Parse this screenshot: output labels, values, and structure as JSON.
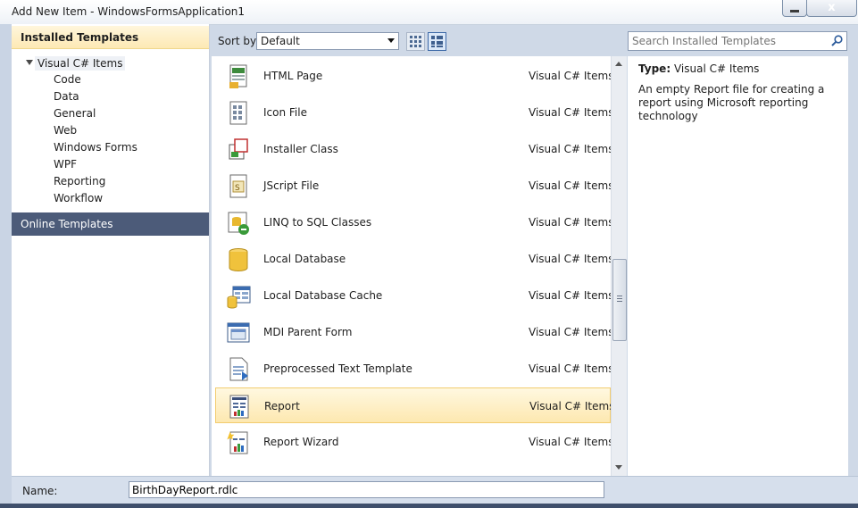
{
  "window": {
    "title": "Add New Item - WindowsFormsApplication1",
    "close_label": "x"
  },
  "left_panel": {
    "installed_header": "Installed Templates",
    "root_label": "Visual C# Items",
    "children": [
      "Code",
      "Data",
      "General",
      "Web",
      "Windows Forms",
      "WPF",
      "Reporting",
      "Workflow"
    ],
    "online_header": "Online Templates"
  },
  "toolbar": {
    "sort_label": "Sort by:",
    "sort_value": "Default",
    "search_placeholder": "Search Installed Templates"
  },
  "templates": [
    {
      "name": "HTML Page",
      "category": "Visual C# Items",
      "icon": "html-page-icon"
    },
    {
      "name": "Icon File",
      "category": "Visual C# Items",
      "icon": "icon-file-icon"
    },
    {
      "name": "Installer Class",
      "category": "Visual C# Items",
      "icon": "installer-class-icon"
    },
    {
      "name": "JScript File",
      "category": "Visual C# Items",
      "icon": "jscript-file-icon"
    },
    {
      "name": "LINQ to SQL Classes",
      "category": "Visual C# Items",
      "icon": "linq-to-sql-icon"
    },
    {
      "name": "Local Database",
      "category": "Visual C# Items",
      "icon": "local-database-icon"
    },
    {
      "name": "Local Database Cache",
      "category": "Visual C# Items",
      "icon": "local-database-cache-icon"
    },
    {
      "name": "MDI Parent Form",
      "category": "Visual C# Items",
      "icon": "mdi-parent-form-icon"
    },
    {
      "name": "Preprocessed Text Template",
      "category": "Visual C# Items",
      "icon": "text-template-icon"
    },
    {
      "name": "Report",
      "category": "Visual C# Items",
      "icon": "report-icon",
      "selected": true
    },
    {
      "name": "Report Wizard",
      "category": "Visual C# Items",
      "icon": "report-wizard-icon"
    }
  ],
  "info": {
    "type_label": "Type:",
    "type_value": "Visual C# Items",
    "description": "An empty Report file for creating a report using Microsoft reporting technology"
  },
  "name_field": {
    "label": "Name:",
    "value": "BirthDayReport.rdlc"
  },
  "colors": {
    "selection": "#fde8b0",
    "online_header": "#4c5b79",
    "installed_header": "#fde9b4"
  }
}
